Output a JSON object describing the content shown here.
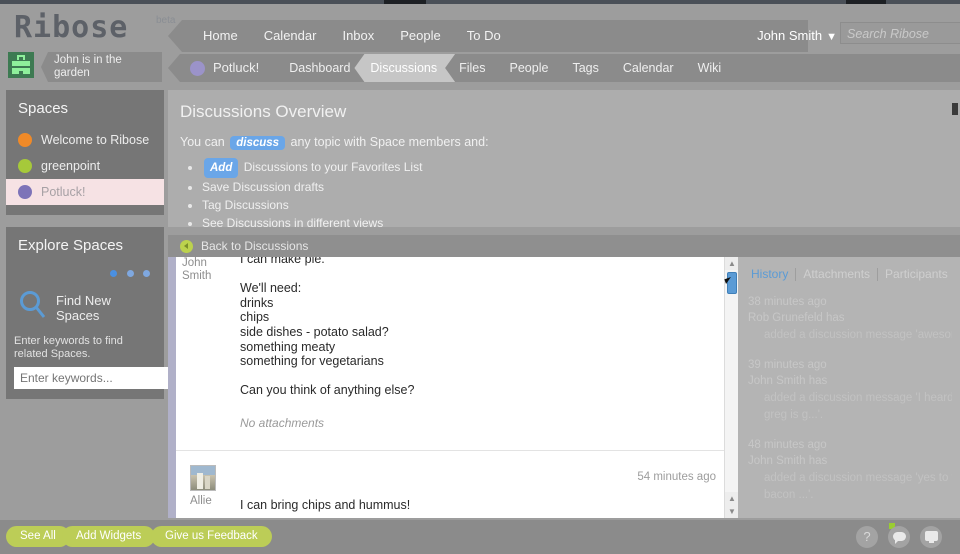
{
  "brand": {
    "name": "Ribose",
    "beta": "beta"
  },
  "header": {
    "nav": [
      {
        "label": "Home"
      },
      {
        "label": "Calendar"
      },
      {
        "label": "Inbox"
      },
      {
        "label": "People"
      },
      {
        "label": "To Do"
      }
    ],
    "user": "John Smith",
    "user_caret": "▼",
    "search_placeholder": "Search Ribose"
  },
  "status": {
    "text_line1": "John is in the",
    "text_line2": "garden",
    "avatar_color": "#3d7a52"
  },
  "space_nav": {
    "space_name": "Potluck!",
    "space_color": "#9b93c9",
    "tabs": [
      {
        "label": "Dashboard",
        "active": false
      },
      {
        "label": "Discussions",
        "active": true
      },
      {
        "label": "Files",
        "active": false
      },
      {
        "label": "People",
        "active": false
      },
      {
        "label": "Tags",
        "active": false
      },
      {
        "label": "Calendar",
        "active": false
      },
      {
        "label": "Wiki",
        "active": false
      }
    ]
  },
  "sidebar": {
    "spaces_title": "Spaces",
    "spaces": [
      {
        "label": "Welcome to Ribose",
        "color": "#f08a28",
        "selected": false
      },
      {
        "label": "greenpoint",
        "color": "#a6c93a",
        "selected": false
      },
      {
        "label": "Potluck!",
        "color": "#7d73b8",
        "selected": true
      }
    ],
    "explore_title": "Explore Spaces",
    "find_label": "Find New Spaces",
    "explore_hint": "Enter keywords to find related Spaces.",
    "keyword_placeholder": "Enter keywords...",
    "keyword_value": "",
    "keyword_go": "▶"
  },
  "overview": {
    "title": "Discussions Overview",
    "intro_before": "You can",
    "intro_pill": "discuss",
    "intro_after": "any topic with Space members and:",
    "bullets": [
      {
        "pill": "Add",
        "text": "Discussions to your Favorites List"
      },
      {
        "pill": "",
        "text": "Save Discussion drafts"
      },
      {
        "pill": "",
        "text": "Tag Discussions"
      },
      {
        "pill": "",
        "text": "See Discussions in different views"
      }
    ],
    "pill_color": "#6aa6e8"
  },
  "backbar": {
    "label": "Back to Discussions",
    "button_color": "#bcd24d"
  },
  "thread": {
    "messages": [
      {
        "author_line1": "John",
        "author_line2": "Smith",
        "lines": [
          "I can make pie.",
          "",
          "We'll need:",
          "drinks",
          "chips",
          "side dishes - potato salad?",
          "something meaty",
          "something for vegetarians",
          "",
          "Can you think of anything else?"
        ],
        "attachments": "No attachments"
      },
      {
        "author": "Allie",
        "time": "54 minutes ago",
        "text": "I can bring chips and hummus!"
      }
    ]
  },
  "history": {
    "tabs": [
      {
        "label": "History",
        "active": true
      },
      {
        "label": "Attachments",
        "active": false
      },
      {
        "label": "Participants",
        "active": false
      }
    ],
    "entries": [
      {
        "time": "38 minutes ago",
        "who": "Rob Grunefeld has",
        "action_line1": "added a discussion message 'awesome",
        "action_line2": ""
      },
      {
        "time": "39 minutes ago",
        "who": "John Smith has",
        "action_line1": "added a discussion message 'I heard",
        "action_line2": "greg is g...'."
      },
      {
        "time": "48 minutes ago",
        "who": "John Smith has",
        "action_line1": "added a discussion message 'yes to th",
        "action_line2": "bacon ...'."
      }
    ]
  },
  "bottom": {
    "buttons": [
      {
        "label": "See All"
      },
      {
        "label": "Add Widgets"
      },
      {
        "label": "Give us Feedback"
      }
    ],
    "button_color": "#bccd57",
    "help_glyph": "?",
    "notification_color": "#9acd32"
  }
}
